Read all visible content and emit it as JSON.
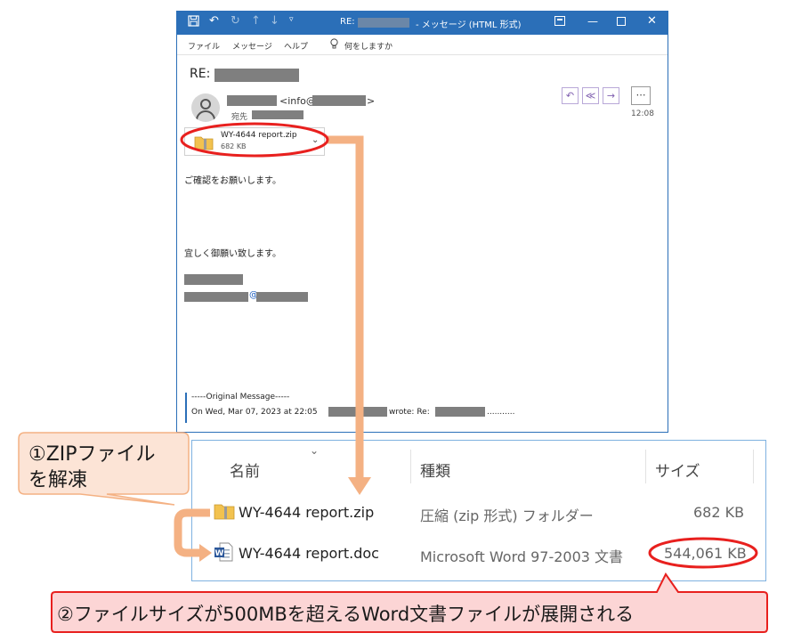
{
  "outlook": {
    "title_prefix": "RE:",
    "title_suffix": "- メッセージ (HTML 形式)",
    "menu": [
      "ファイル",
      "メッセージ",
      "ヘルプ",
      "何をしますか"
    ],
    "subject_prefix": "RE:",
    "sender_email_prefix": "<info@",
    "sender_email_suffix": ">",
    "to_label": "宛先",
    "time": "12:08",
    "attachment": {
      "name": "WY-4644 report.zip",
      "size": "682 KB"
    },
    "body_line1": "ご確認をお願いします。",
    "body_line2": "宜しく御願い致します。",
    "at_symbol": "@",
    "quote_header": "-----Original Message-----",
    "quote_line_prefix": "On Wed, Mar 07, 2023 at 22:05",
    "quote_line_mid": "wrote: Re:",
    "quote_line_suffix": "..........."
  },
  "explorer": {
    "columns": [
      "名前",
      "種類",
      "サイズ"
    ],
    "rows": [
      {
        "name": "WY-4644 report.zip",
        "type": "圧縮 (zip 形式) フォルダー",
        "size": "682 KB",
        "icon": "zip-folder-icon"
      },
      {
        "name": "WY-4644 report.doc",
        "type": "Microsoft Word 97-2003 文書",
        "size": "544,061 KB",
        "icon": "word-doc-icon"
      }
    ]
  },
  "callouts": {
    "step1_line1": "①ZIPファイル",
    "step1_line2": "を解凍",
    "step2": "②ファイルサイズが500MBを超えるWord文書ファイルが展開される"
  },
  "colors": {
    "outlook_blue": "#2b6fb8",
    "highlight_red": "#e8201e",
    "arrow_orange": "#f4b183",
    "callout_fill": "#fce4d6",
    "callout_border": "#f4b183",
    "banner_fill": "#fcd5d5",
    "redaction": "#7f7f7f"
  }
}
